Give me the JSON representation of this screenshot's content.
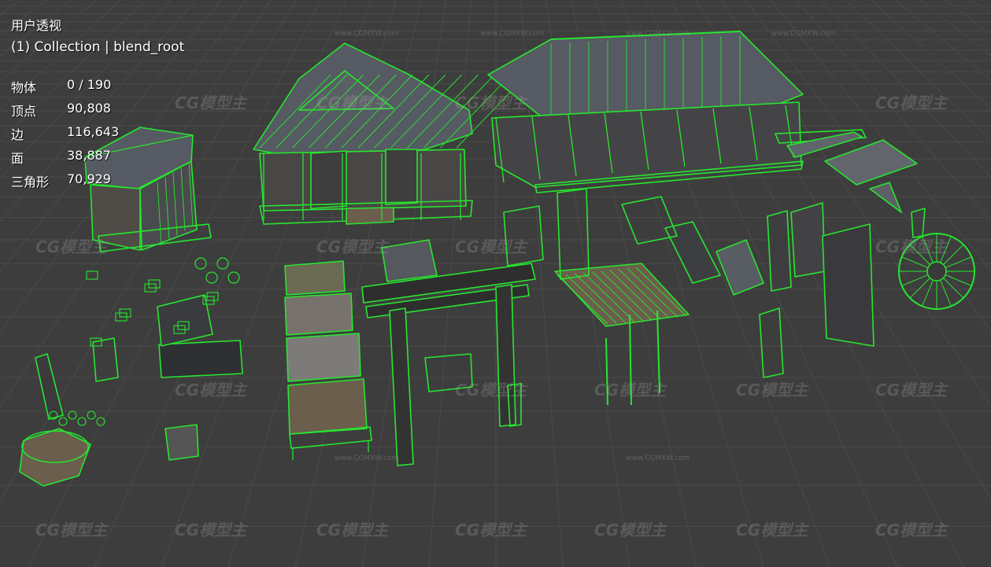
{
  "viewport": {
    "view_name": "用户透视",
    "collection_line": "(1) Collection | blend_root"
  },
  "stats": [
    {
      "label": "物体",
      "value": "0 / 190"
    },
    {
      "label": "顶点",
      "value": "90,808"
    },
    {
      "label": "边",
      "value": "116,643"
    },
    {
      "label": "面",
      "value": "38,887"
    },
    {
      "label": "三角形",
      "value": "70,929"
    }
  ],
  "watermark": {
    "logo_text": "CG模型主",
    "url_text": "www.CGMXW.com"
  },
  "colors": {
    "background": "#3d3d3d",
    "grid": "#4a4a4a",
    "wireframe": "#27e62f",
    "roof": "#565a63",
    "floor": "#6b5e4c",
    "overlay_text": "#ffffff"
  }
}
